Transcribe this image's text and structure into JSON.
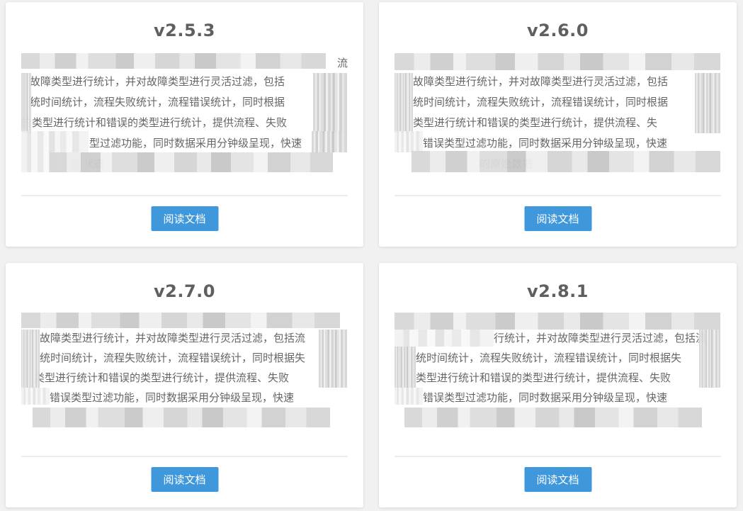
{
  "cards": [
    {
      "version": "v2.5.3",
      "lines": [
        "流",
        "故障类型进行统计，并对故障类型进行灵活过滤，包括",
        "统时间统计，流程失败统计，流程错误统计，同时根据",
        "的类型进行统计和错误的类型进行统计，提供流程、失败",
        "型过滤功能，同时数据采用分钟级呈现，快速",
        "间状态"
      ],
      "button_label": "阅读文档"
    },
    {
      "version": "v2.6.0",
      "lines": [
        "",
        "故障类型进行统计，并对故障类型进行灵活过滤，包括",
        "统时间统计，流程失败统计，流程错误统计，同时根据",
        "类型进行统计和错误的类型进行统计，提供流程、失",
        "错误类型过滤功能，同时数据采用分钟级呈现，快速",
        "的原始数据"
      ],
      "button_label": "阅读文档"
    },
    {
      "version": "v2.7.0",
      "lines": [
        "",
        "故障类型进行统计，并对故障类型进行灵活过滤，包括流",
        "统时间统计，流程失败统计，流程错误统计，同时根据失",
        "类型进行统计和错误的类型进行统计，提供流程、失败",
        "错误类型过滤功能，同时数据采用分钟级呈现，快速",
        ""
      ],
      "button_label": "阅读文档"
    },
    {
      "version": "v2.8.1",
      "lines": [
        "",
        "行统计，并对故障类型进行灵活过滤，包括流",
        "统时间统计，流程失败统计，流程错误统计，同时根据失",
        "类型进行统计和错误的类型进行统计，提供流程、失败",
        "错误类型过滤功能，同时数据采用分钟级呈现，快速",
        ""
      ],
      "button_label": "阅读文档"
    }
  ],
  "colors": {
    "page_bg": "#f1f1f1",
    "card_bg": "#ffffff",
    "version_text": "#5f5f5f",
    "body_text": "#666666",
    "button_bg": "#3f98dc",
    "button_text": "#ffffff",
    "divider": "#ececec"
  }
}
